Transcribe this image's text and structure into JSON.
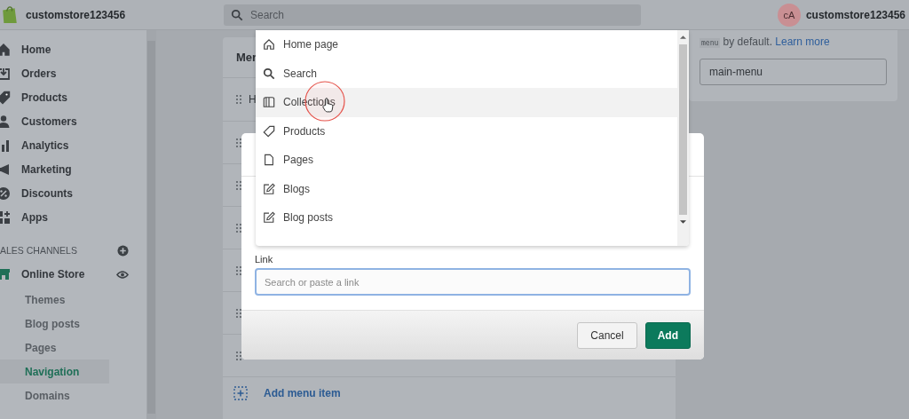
{
  "top_bar": {
    "store_name": "customstore123456",
    "search_placeholder": "Search",
    "avatar": "cA",
    "account_name": "customstore123456"
  },
  "sidebar": {
    "items": [
      {
        "label": "Home",
        "kind": "home",
        "selected": false
      },
      {
        "label": "Orders",
        "kind": "orders",
        "selected": false
      },
      {
        "label": "Products",
        "kind": "tag",
        "selected": false
      },
      {
        "label": "Customers",
        "kind": "person",
        "selected": false
      },
      {
        "label": "Analytics",
        "kind": "bars",
        "selected": false
      },
      {
        "label": "Marketing",
        "kind": "megaphone",
        "selected": false
      },
      {
        "label": "Discounts",
        "kind": "discount",
        "selected": false
      },
      {
        "label": "Apps",
        "kind": "apps",
        "selected": false
      }
    ],
    "sales_channels_heading": "ALES CHANNELS",
    "channel": {
      "label": "Online Store"
    },
    "sub_items": [
      {
        "label": "Themes",
        "selected": false
      },
      {
        "label": "Blog posts",
        "selected": false
      },
      {
        "label": "Pages",
        "selected": false
      },
      {
        "label": "Navigation",
        "selected": true
      },
      {
        "label": "Domains",
        "selected": false
      }
    ]
  },
  "menu_card": {
    "title": "Mer",
    "rows": [
      {
        "label": "H"
      }
    ],
    "add_link": "Add menu item"
  },
  "handle_card": {
    "code": "menu",
    "text": " by default. ",
    "link": "Learn more",
    "handle_value": "main-menu"
  },
  "dropdown": {
    "items": [
      {
        "label": "Home page",
        "kind": "home",
        "selected": false
      },
      {
        "label": "Search",
        "kind": "search",
        "selected": false
      },
      {
        "label": "Collections",
        "kind": "book",
        "selected": true
      },
      {
        "label": "Products",
        "kind": "tag",
        "selected": false
      },
      {
        "label": "Pages",
        "kind": "page",
        "selected": false
      },
      {
        "label": "Blogs",
        "kind": "edit",
        "selected": false
      },
      {
        "label": "Blog posts",
        "kind": "edit",
        "selected": false
      }
    ]
  },
  "modal": {
    "link_label": "Link",
    "link_placeholder": "Search or paste a link",
    "buttons": [
      {
        "label": "Cancel",
        "kind": "secondary"
      },
      {
        "label": "Add",
        "kind": "primary"
      }
    ]
  }
}
